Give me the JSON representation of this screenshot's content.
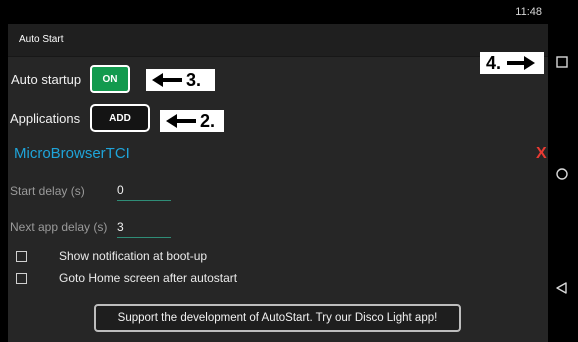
{
  "status": {
    "time": "11:48"
  },
  "action_bar": {
    "title": "Auto Start"
  },
  "autostart": {
    "label": "Auto startup",
    "toggle_label": "ON"
  },
  "applications": {
    "label": "Applications",
    "add_label": "ADD",
    "entry": "MicroBrowserTCI",
    "remove": "X"
  },
  "callouts": {
    "step3": "3.",
    "step2": "2.",
    "step4": "4."
  },
  "fields": {
    "start_delay": {
      "label": "Start delay (s)",
      "value": "0"
    },
    "next_delay": {
      "label": "Next app delay (s)",
      "value": "3"
    }
  },
  "options": [
    {
      "label": "Show notification at boot-up",
      "checked": false
    },
    {
      "label": "Goto Home screen after autostart",
      "checked": false
    }
  ],
  "support": {
    "label": "Support the development of AutoStart. Try our Disco Light app!"
  },
  "colors": {
    "on_green": "#129a4e",
    "accent_blue": "#1fa4d9",
    "remove_red": "#e83a32",
    "background": "#262626"
  },
  "icons": {
    "nav": [
      "recents-square-icon",
      "home-circle-icon",
      "back-triangle-icon"
    ]
  }
}
